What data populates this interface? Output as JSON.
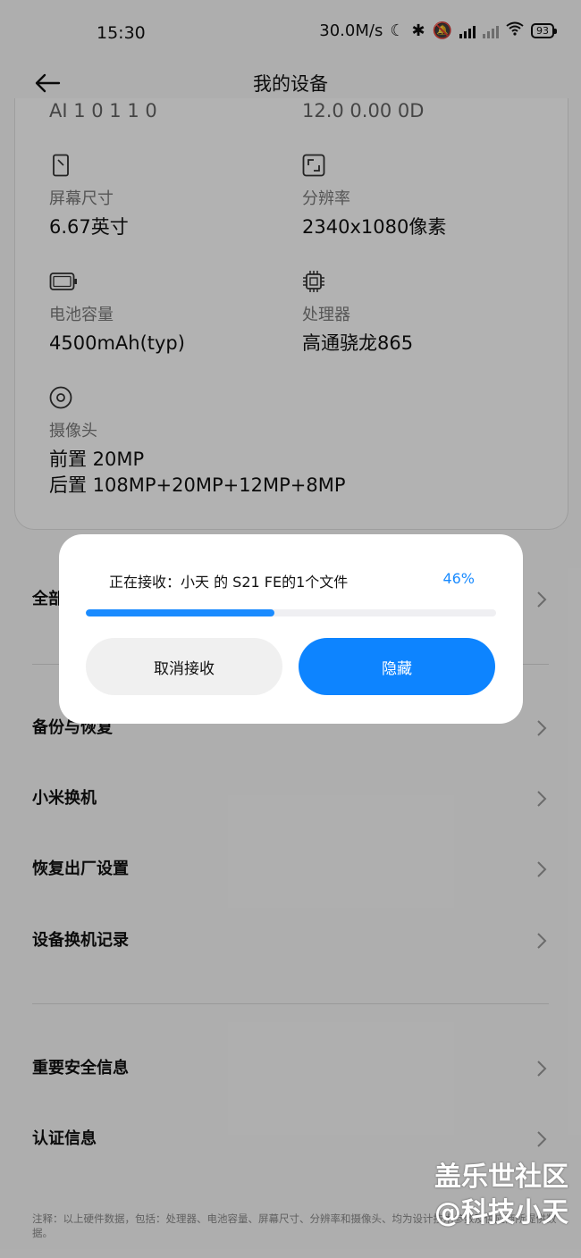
{
  "status_bar": {
    "time": "15:30",
    "net_speed": "30.0M/s",
    "battery": "93"
  },
  "header": {
    "title": "我的设备"
  },
  "specs_cut_top": {
    "left": "AI 1 0 1 1 0",
    "right": "12.0 0.00 0D"
  },
  "specs": [
    {
      "icon": "screen-icon",
      "label": "屏幕尺寸",
      "value": "6.67英寸"
    },
    {
      "icon": "resolution-icon",
      "label": "分辨率",
      "value": "2340x1080像素"
    },
    {
      "icon": "battery-icon",
      "label": "电池容量",
      "value": "4500mAh(typ)"
    },
    {
      "icon": "processor-icon",
      "label": "处理器",
      "value": "高通骁龙865"
    },
    {
      "icon": "camera-icon",
      "label": "摄像头",
      "value": "前置 20MP",
      "value2": "后置 108MP+20MP+12MP+8MP"
    }
  ],
  "menu": {
    "all_params": "全部参数",
    "backup": "备份与恢复",
    "migrate": "小米换机",
    "factory_reset": "恢复出厂设置",
    "migration_log": "设备换机记录",
    "safety_info": "重要安全信息",
    "certification": "认证信息"
  },
  "footnote": "注释：以上硬件数据，包括：处理器、电池容量、屏幕尺寸、分辨率和摄像头、均为设计技术参数及供应商所提供数据。",
  "dialog": {
    "message": "正在接收：小天 的 S21 FE的1个文件",
    "percent_text": "46%",
    "progress": 0.46,
    "cancel_label": "取消接收",
    "hide_label": "隐藏"
  },
  "watermark": {
    "line1": "盖乐世社区",
    "line2": "@科技小天"
  },
  "colors": {
    "accent": "#0d84ff",
    "progress": "#1a8bff"
  }
}
